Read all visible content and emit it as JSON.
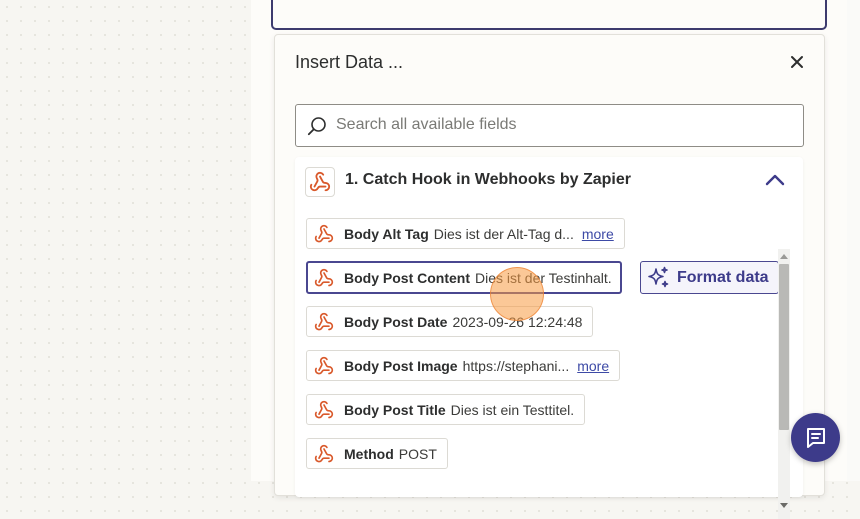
{
  "dialog": {
    "title": "Insert Data ...",
    "close_icon": "close-icon"
  },
  "search": {
    "placeholder": "Search all available fields",
    "value": ""
  },
  "section": {
    "title": "1. Catch Hook in Webhooks by Zapier",
    "icon": "webhook-icon",
    "collapse_icon": "chevron-up-icon"
  },
  "fields": [
    {
      "label": "Body Alt Tag",
      "value": "Dies ist der Alt-Tag d...",
      "more": "more"
    },
    {
      "label": "Body Post Content",
      "value": "Dies ist der Testinhalt.",
      "selected": true
    },
    {
      "label": "Body Post Date",
      "value": "2023-09-26 12:24:48"
    },
    {
      "label": "Body Post Image",
      "value": "https://stephani...",
      "more": "more"
    },
    {
      "label": "Body Post Title",
      "value": "Dies ist ein Testtitel."
    },
    {
      "label": "Method",
      "value": "POST"
    }
  ],
  "format_button": {
    "label": "Format data",
    "icon": "sparkle-icon"
  },
  "chat": {
    "icon": "chat-icon"
  },
  "colors": {
    "accent": "#3d3b8a",
    "webhook_orange": "#d9592b",
    "cursor_highlight": "#f89a42"
  }
}
